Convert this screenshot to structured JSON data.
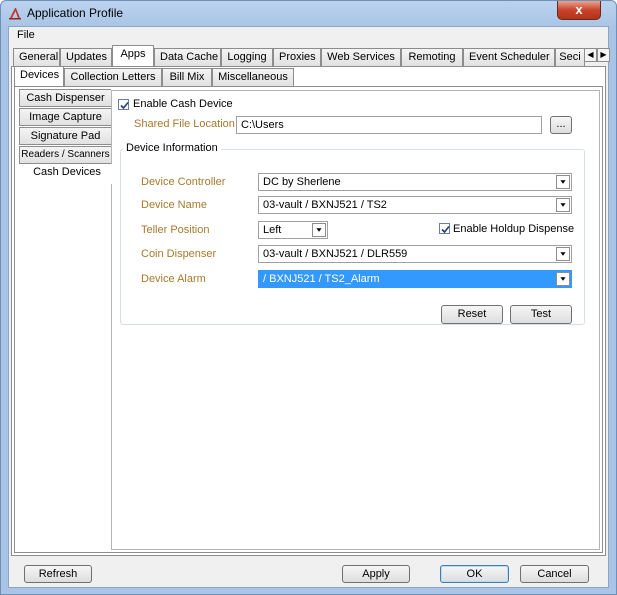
{
  "window": {
    "title": "Application Profile",
    "close_label": "x"
  },
  "menu": {
    "file": "File"
  },
  "top_tabs": [
    "General",
    "Updates",
    "Apps",
    "Data Cache",
    "Logging",
    "Proxies",
    "Web Services",
    "Remoting",
    "Event Scheduler",
    "Seci"
  ],
  "sub_tabs": [
    "Devices",
    "Collection Letters",
    "Bill Mix",
    "Miscellaneous"
  ],
  "side_tabs": [
    "Cash Dispenser",
    "Image Capture",
    "Signature Pad",
    "Readers / Scanners",
    "Cash Devices"
  ],
  "cash_device": {
    "enable_label": "Enable Cash Device",
    "enable_checked": true,
    "shared_file_label": "Shared File Location",
    "shared_file_value": "C:\\Users",
    "browse_label": "...",
    "group_title": "Device Information",
    "device_controller_label": "Device Controller",
    "device_controller_value": "DC by Sherlene",
    "device_name_label": "Device Name",
    "device_name_value": "03-vault / BXNJ521 / TS2",
    "teller_position_label": "Teller Position",
    "teller_position_value": "Left",
    "holdup_label": "Enable Holdup Dispense",
    "holdup_checked": true,
    "coin_dispenser_label": "Coin Dispenser",
    "coin_dispenser_value": "03-vault / BXNJ521 / DLR559",
    "device_alarm_label": "Device Alarm",
    "device_alarm_value": " / BXNJ521 / TS2_Alarm",
    "reset_label": "Reset",
    "test_label": "Test"
  },
  "footer": {
    "refresh": "Refresh",
    "apply": "Apply",
    "ok": "OK",
    "cancel": "Cancel"
  }
}
